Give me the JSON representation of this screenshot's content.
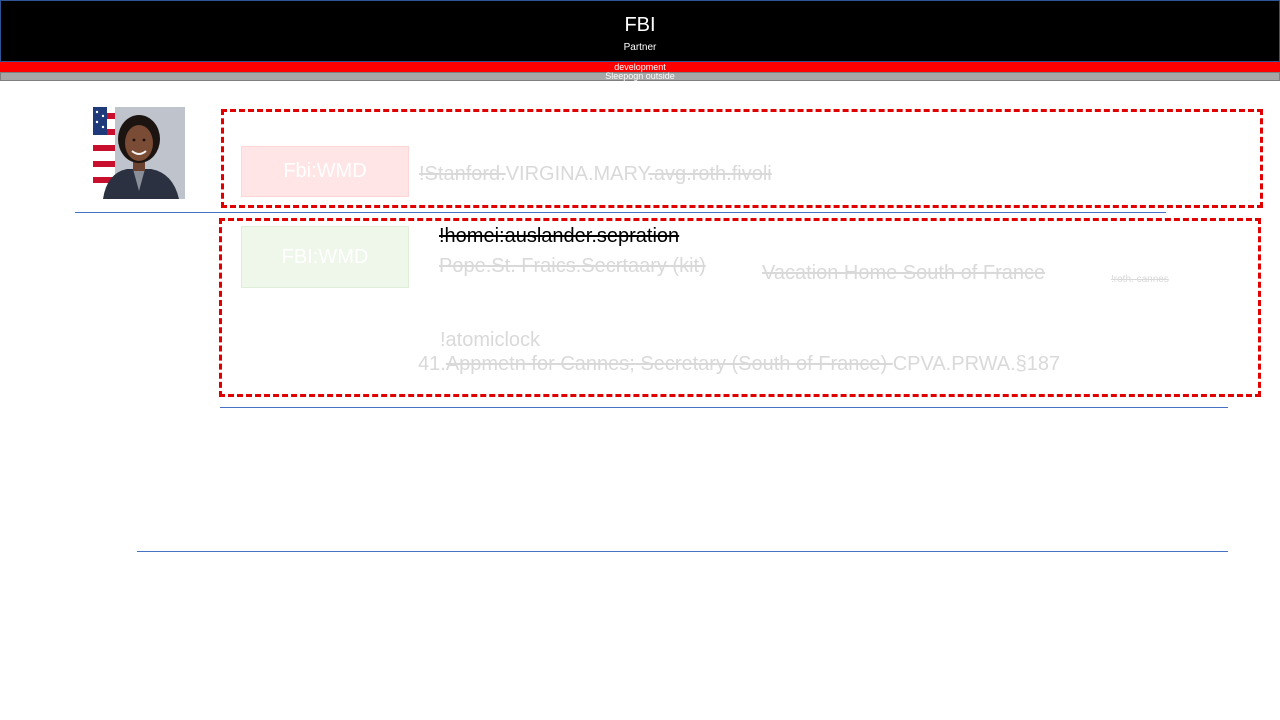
{
  "header": {
    "title": "FBI",
    "subtitle": "Partner"
  },
  "bars": {
    "red_label": "development",
    "grey_label": "Sleepogn outside"
  },
  "colors": {
    "header_bg": "#000000",
    "accent_red": "#ff0000",
    "divider_blue": "#4472c4",
    "dashed_red": "#e00000"
  },
  "row1": {
    "tag": "Fbi:WMD",
    "text_struck_1": "!Stanford.",
    "text_plain": "VIRGINA.MARY",
    "text_struck_2": ".avg.roth.fivoli"
  },
  "row2": {
    "tag": "FBI:WMD",
    "homei": "!homei:auslander.sepration",
    "pope": "Pope.St. Fraics.Secrtaary (kit)",
    "vacation": "Vacation Home South of France",
    "roth_cannes": "!roth. cannes",
    "atomic": "!atomiclock",
    "appt_num": "41.",
    "appt_struck": "Appmetn for Cannes; Secretary (South of France) ",
    "appt_code": "CPVA.PRWA.§187"
  }
}
